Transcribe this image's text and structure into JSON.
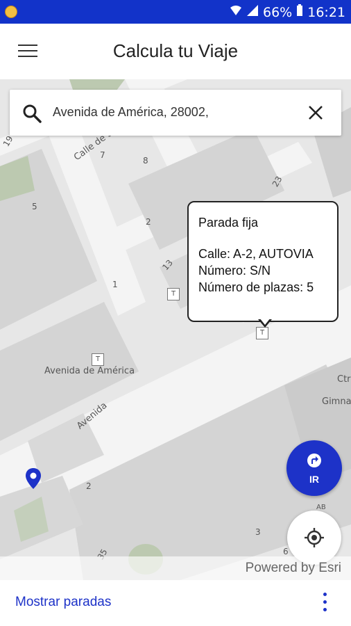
{
  "status_bar": {
    "battery": "66%",
    "time": "16:21",
    "colors": {
      "background": "#1233c9"
    }
  },
  "app_bar": {
    "title": "Calcula tu Viaje",
    "menu_icon": "hamburger-menu-icon"
  },
  "search": {
    "value": "Avenida de América, 28002,",
    "search_icon": "search-icon",
    "clear_icon": "close-icon"
  },
  "popup": {
    "title": "Parada fija",
    "street": "Calle: A-2, AUTOVIA",
    "number": "Número: S/N",
    "spaces": "Número de plazas: 5"
  },
  "map": {
    "street_labels": [
      "Calle de San Fernando",
      "Avenida de América",
      "Avenida",
      "Ctr",
      "Gimna"
    ],
    "building_numbers": [
      "19",
      "7",
      "8",
      "5",
      "2",
      "13",
      "23",
      "2",
      "3",
      "AB",
      "35",
      "6",
      "1"
    ],
    "taxi_stop_icon": "taxi-stop-icon",
    "location_pin_icon": "location-pin-icon"
  },
  "buttons": {
    "go_label": "IR",
    "go_icon": "turn-direction-icon",
    "locate_icon": "my-location-icon"
  },
  "attribution": "Powered by Esri",
  "bottom_bar": {
    "show_stops": "Mostrar paradas",
    "more_icon": "more-vertical-icon"
  },
  "colors": {
    "accent": "#1d32c8",
    "map_background": "#e7e7e7",
    "map_block": "#d4d4d4",
    "green_area": "#bcc9b0"
  }
}
